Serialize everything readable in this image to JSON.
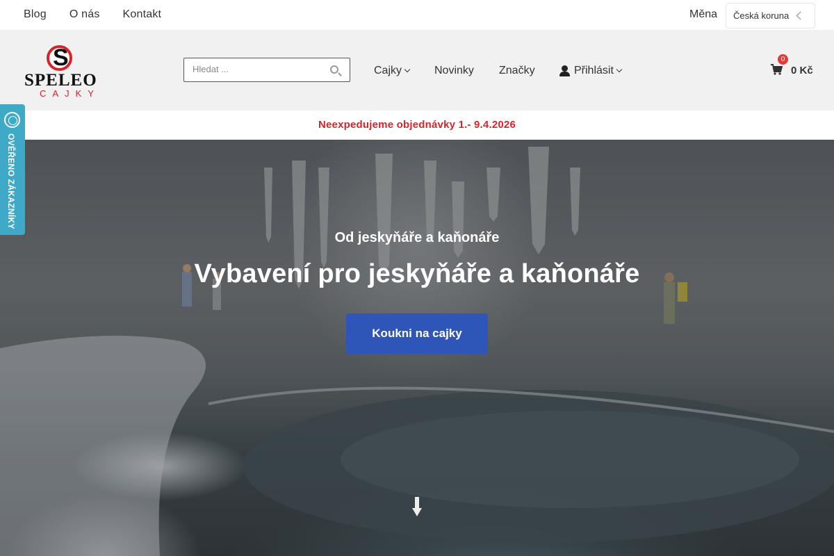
{
  "topbar": {
    "links": [
      "Blog",
      "O nás",
      "Kontakt"
    ],
    "currency_label": "Měna",
    "currency_value": "Česká koruna"
  },
  "header": {
    "logo": {
      "text_main": "SPELEO",
      "text_sub": "CAJKY",
      "initial": "S"
    },
    "search_placeholder": "Hledat ...",
    "nav": {
      "cajky": "Cajky",
      "novinky": "Novinky",
      "znacky": "Značky",
      "login": "Přihlásit"
    },
    "cart": {
      "count": "0",
      "total": "0 Kč"
    }
  },
  "notice": "Neexpedujeme objednávky 1.- 9.4.2026",
  "hero": {
    "subtitle": "Od jeskyňáře a kaňonáře",
    "title": "Vybavení pro jeskyňáře a kaňonáře",
    "cta_label": "Koukni na cajky"
  },
  "verified_badge": "OVĚŘENO ZÁKAZNÍKY",
  "colors": {
    "accent_red": "#d6242a",
    "cta_blue": "#2d56b8",
    "badge_teal": "#3fa9c8"
  }
}
